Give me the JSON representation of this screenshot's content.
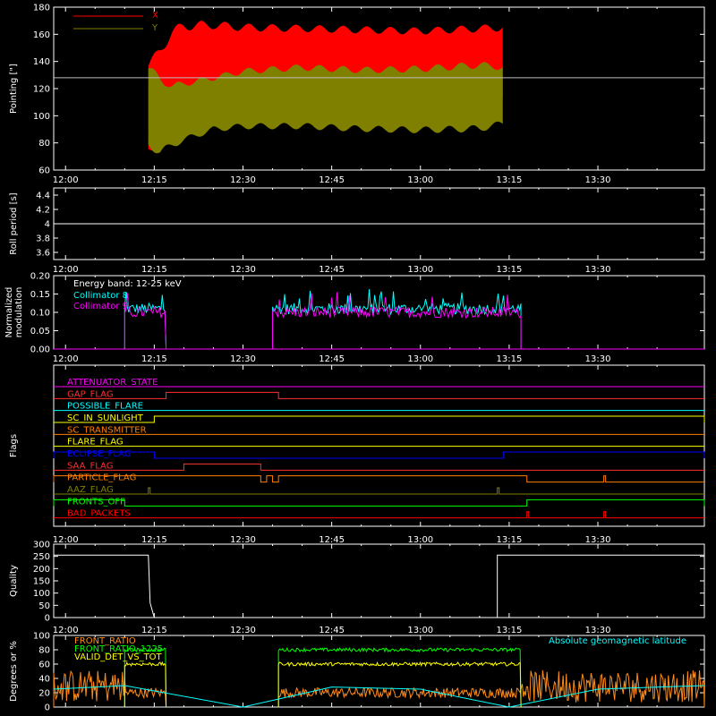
{
  "time_ticks": [
    "12:00",
    "12:15",
    "12:30",
    "12:45",
    "13:00",
    "13:15",
    "13:30"
  ],
  "chart_data": [
    {
      "type": "area",
      "name": "pointing",
      "ylabel": "Pointing [\"]",
      "ylim": [
        60,
        180
      ],
      "yticks": [
        60,
        80,
        100,
        120,
        140,
        160,
        180
      ],
      "series": [
        {
          "name": "X",
          "color": "#ff0000",
          "x": [
            "12:14",
            "12:16",
            "12:18",
            "12:20",
            "12:25",
            "12:30",
            "12:40",
            "12:50",
            "13:00",
            "13:10",
            "13:14"
          ],
          "low": [
            72,
            78,
            90,
            96,
            108,
            110,
            114,
            112,
            113,
            112,
            110
          ],
          "high": [
            140,
            152,
            165,
            170,
            170,
            168,
            167,
            166,
            165,
            167,
            168
          ]
        },
        {
          "name": "Y",
          "color": "#808000",
          "x": [
            "12:14",
            "12:16",
            "12:18",
            "12:20",
            "12:25",
            "12:30",
            "12:40",
            "12:50",
            "13:00",
            "13:10",
            "13:14"
          ],
          "low": [
            76,
            70,
            76,
            80,
            88,
            90,
            90,
            88,
            87,
            88,
            92
          ],
          "high": [
            138,
            130,
            124,
            126,
            130,
            135,
            138,
            136,
            137,
            140,
            138
          ]
        }
      ],
      "reference_line": 128,
      "legend_position": "top-left"
    },
    {
      "type": "line",
      "name": "roll-period",
      "ylabel": "Roll period [s]",
      "ylim": [
        3.5,
        4.5
      ],
      "yticks": [
        3.6,
        3.8,
        4.0,
        4.2,
        4.4
      ],
      "series": [
        {
          "name": "",
          "color": "#ffffff",
          "x": [
            "11:58",
            "13:48"
          ],
          "y": [
            4.0,
            4.0
          ]
        }
      ]
    },
    {
      "type": "line",
      "name": "modulation",
      "ylabel": "Normalized modulation",
      "ylim": [
        0,
        0.2
      ],
      "yticks": [
        "0.00",
        "0.05",
        "0.10",
        "0.15",
        "0.20"
      ],
      "annotation": "Energy band: 12-25 keV",
      "series": [
        {
          "name": "Collimator 8",
          "color": "#00ffff",
          "level": 0.11,
          "segments": [
            [
              "12:10",
              "12:17"
            ],
            [
              "12:35",
              "13:17"
            ]
          ]
        },
        {
          "name": "Collimator 9",
          "color": "#ff00ff",
          "level": 0.1,
          "segments": [
            [
              "12:10",
              "12:17"
            ],
            [
              "12:35",
              "13:17"
            ]
          ]
        }
      ],
      "legend_position": "top-left"
    },
    {
      "type": "line",
      "name": "flags",
      "ylabel": "Flags",
      "flags": [
        {
          "label": "ATTENUATOR_STATE",
          "color": "#ff00ff",
          "high": []
        },
        {
          "label": "GAP_FLAG",
          "color": "#ff3030",
          "high": [
            [
              "12:17",
              "12:36"
            ]
          ]
        },
        {
          "label": "POSSIBLE_FLARE",
          "color": "#00ffff",
          "high": []
        },
        {
          "label": "SC_IN_SUNLIGHT",
          "color": "#ffff00",
          "high": [
            [
              "12:15",
              "13:48"
            ]
          ]
        },
        {
          "label": "SC_TRANSMITTER",
          "color": "#ff7f00",
          "high": []
        },
        {
          "label": "FLARE_FLAG",
          "color": "#ffff00",
          "high": []
        },
        {
          "label": "ECLIPSE_FLAG",
          "color": "#0000ff",
          "high": [
            [
              "11:58",
              "12:15"
            ],
            [
              "13:14",
              "13:48"
            ]
          ]
        },
        {
          "label": "SAA_FLAG",
          "color": "#ff3030",
          "high": [
            [
              "12:20",
              "12:33"
            ]
          ]
        },
        {
          "label": "PARTICLE_FLAG",
          "color": "#ff7f00",
          "high": [
            [
              "11:58",
              "12:33"
            ],
            [
              "12:34",
              "12:35"
            ],
            [
              "12:36",
              "13:18"
            ],
            [
              "13:31",
              "13:31"
            ]
          ]
        },
        {
          "label": "AAZ_FLAG",
          "color": "#808000",
          "high": [
            [
              "12:14",
              "12:14"
            ],
            [
              "13:13",
              "13:13"
            ]
          ]
        },
        {
          "label": "FRONTS_OFF",
          "color": "#00ff00",
          "high": [
            [
              "11:58",
              "12:10"
            ],
            [
              "13:18",
              "13:48"
            ]
          ]
        },
        {
          "label": "BAD_PACKETS",
          "color": "#ff0000",
          "high": [
            [
              "13:18",
              "13:18"
            ],
            [
              "13:31",
              "13:31"
            ]
          ]
        }
      ]
    },
    {
      "type": "line",
      "name": "quality",
      "ylabel": "Quality",
      "ylim": [
        0,
        300
      ],
      "yticks": [
        0,
        50,
        100,
        150,
        200,
        250,
        300
      ],
      "series": [
        {
          "name": "",
          "color": "#ffffff",
          "x": [
            "11:58",
            "12:14",
            "12:14.3",
            "12:15",
            "13:13",
            "13:13",
            "13:48"
          ],
          "y": [
            255,
            255,
            60,
            0,
            0,
            255,
            255
          ]
        }
      ]
    },
    {
      "type": "line",
      "name": "front-ratio",
      "ylabel": "Degrees or %",
      "ylim": [
        0,
        100
      ],
      "yticks": [
        0,
        20,
        40,
        60,
        80,
        100
      ],
      "series": [
        {
          "name": "FRONT_RATIO",
          "color": "#ff8c1a",
          "segments": [
            [
              "11:58",
              "12:17"
            ],
            [
              "12:36",
              "13:48"
            ]
          ],
          "level": 20
        },
        {
          "name": "FRONT_RATIO_1225",
          "color": "#00ff00",
          "segments": [
            [
              "12:10",
              "12:17"
            ],
            [
              "12:36",
              "13:17"
            ]
          ],
          "level": 80
        },
        {
          "name": "VALID_DET_VS_TOT",
          "color": "#ffff00",
          "segments": [
            [
              "12:10",
              "12:17"
            ],
            [
              "12:36",
              "13:17"
            ]
          ],
          "level": 60
        },
        {
          "name": "Absolute geomagnetic latitude",
          "color": "#00ffff",
          "x": [
            "11:58",
            "12:10",
            "12:30",
            "12:45",
            "13:00",
            "13:15",
            "13:30",
            "13:48"
          ],
          "y": [
            25,
            30,
            0,
            28,
            25,
            0,
            25,
            30
          ]
        }
      ]
    }
  ]
}
